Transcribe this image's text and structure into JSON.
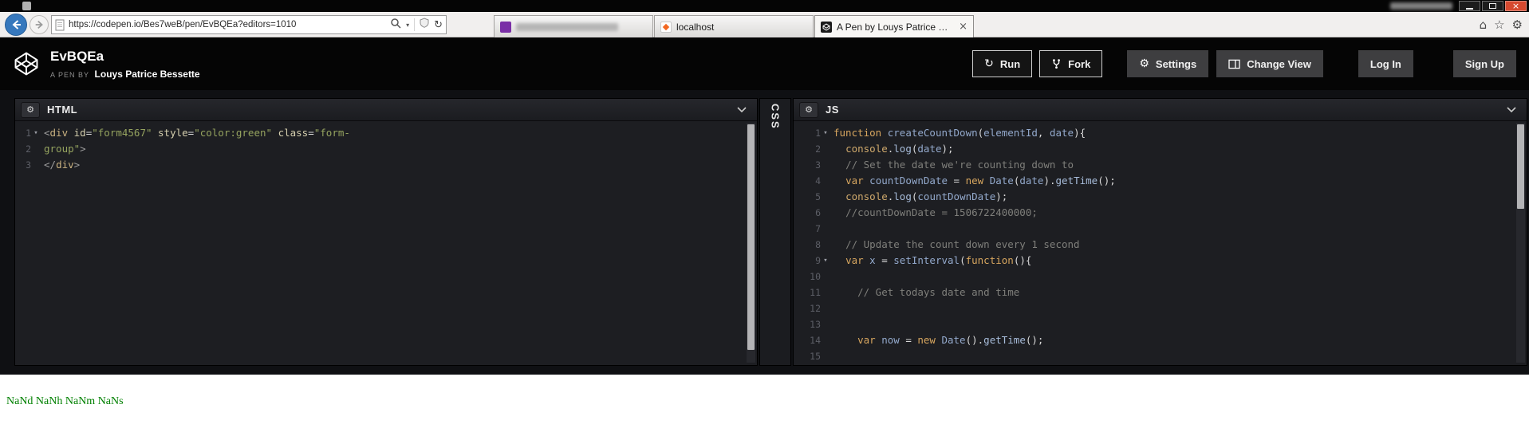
{
  "colors": {
    "output_text": "#008000",
    "back_button_accent": "#3678bd",
    "close_button": "#d6492f",
    "editor_background": "#1d1e22"
  },
  "browser": {
    "url": "https://codepen.io/Bes7weB/pen/EvBQEa?editors=1010",
    "tabs": [
      {
        "label": "",
        "blurred": true
      },
      {
        "label": "localhost",
        "blurred": false
      },
      {
        "label": "A Pen by Louys Patrice Bess...",
        "blurred": false,
        "active": true,
        "close_glyph": "×"
      }
    ],
    "icons": {
      "home": "⌂",
      "favorites": "☆",
      "tools": "⚙",
      "refresh": "↻",
      "caret_down": "▾",
      "close_window": "×"
    }
  },
  "header": {
    "pen_title": "EvBQEa",
    "byline_prefix": "A PEN BY",
    "author": "Louys Patrice Bessette",
    "buttons": {
      "run": "Run",
      "fork": "Fork",
      "settings": "Settings",
      "change_view": "Change View",
      "log_in": "Log In",
      "sign_up": "Sign Up"
    },
    "icons": {
      "run": "↻",
      "settings": "⚙"
    }
  },
  "editors": {
    "gear_glyph": "⚙",
    "fold_glyph": "▾",
    "html": {
      "label": "HTML",
      "lines": [
        {
          "n": "1",
          "fold": true,
          "t": [
            [
              "br",
              "<"
            ],
            [
              "tag",
              "div"
            ],
            [
              "pl",
              " "
            ],
            [
              "attr",
              "id"
            ],
            [
              "op",
              "="
            ],
            [
              "str",
              "\"form4567\""
            ],
            [
              "pl",
              " "
            ],
            [
              "attr",
              "style"
            ],
            [
              "op",
              "="
            ],
            [
              "str",
              "\"color:green\""
            ],
            [
              "pl",
              " "
            ],
            [
              "attr",
              "class"
            ],
            [
              "op",
              "="
            ],
            [
              "str",
              "\"form-"
            ]
          ]
        },
        {
          "n": "2",
          "t": [
            [
              "str",
              "group\""
            ],
            [
              "br",
              ">"
            ]
          ]
        },
        {
          "n": "3",
          "t": [
            [
              "br",
              "</"
            ],
            [
              "tag",
              "div"
            ],
            [
              "br",
              ">"
            ]
          ]
        }
      ]
    },
    "css": {
      "label": "CSS"
    },
    "js": {
      "label": "JS",
      "lines": [
        {
          "n": "1",
          "fold": true,
          "t": [
            [
              "kw",
              "function"
            ],
            [
              "pl",
              " "
            ],
            [
              "def",
              "createCountDown"
            ],
            [
              "pl",
              "("
            ],
            [
              "def",
              "elementId"
            ],
            [
              "pl",
              ", "
            ],
            [
              "def",
              "date"
            ],
            [
              "pl",
              "){"
            ]
          ]
        },
        {
          "n": "2",
          "t": [
            [
              "pl",
              "  "
            ],
            [
              "vr",
              "console"
            ],
            [
              "pl",
              "."
            ],
            [
              "prop",
              "log"
            ],
            [
              "pl",
              "("
            ],
            [
              "def",
              "date"
            ],
            [
              "pl",
              ");"
            ]
          ]
        },
        {
          "n": "3",
          "t": [
            [
              "pl",
              "  "
            ],
            [
              "cm",
              "// Set the date we're counting down to"
            ]
          ]
        },
        {
          "n": "4",
          "t": [
            [
              "pl",
              "  "
            ],
            [
              "kw",
              "var"
            ],
            [
              "pl",
              " "
            ],
            [
              "def",
              "countDownDate"
            ],
            [
              "pl",
              " = "
            ],
            [
              "kw",
              "new"
            ],
            [
              "pl",
              " "
            ],
            [
              "def",
              "Date"
            ],
            [
              "pl",
              "("
            ],
            [
              "def",
              "date"
            ],
            [
              "pl",
              ")."
            ],
            [
              "prop",
              "getTime"
            ],
            [
              "pl",
              "();"
            ]
          ]
        },
        {
          "n": "5",
          "t": [
            [
              "pl",
              "  "
            ],
            [
              "vr",
              "console"
            ],
            [
              "pl",
              "."
            ],
            [
              "prop",
              "log"
            ],
            [
              "pl",
              "("
            ],
            [
              "def",
              "countDownDate"
            ],
            [
              "pl",
              ");"
            ]
          ]
        },
        {
          "n": "6",
          "t": [
            [
              "pl",
              "  "
            ],
            [
              "cm",
              "//countDownDate = 1506722400000;"
            ]
          ]
        },
        {
          "n": "7",
          "t": []
        },
        {
          "n": "8",
          "t": [
            [
              "pl",
              "  "
            ],
            [
              "cm",
              "// Update the count down every 1 second"
            ]
          ]
        },
        {
          "n": "9",
          "fold": true,
          "t": [
            [
              "pl",
              "  "
            ],
            [
              "kw",
              "var"
            ],
            [
              "pl",
              " "
            ],
            [
              "def",
              "x"
            ],
            [
              "pl",
              " = "
            ],
            [
              "def",
              "setInterval"
            ],
            [
              "pl",
              "("
            ],
            [
              "kw",
              "function"
            ],
            [
              "pl",
              "(){"
            ]
          ]
        },
        {
          "n": "10",
          "t": []
        },
        {
          "n": "11",
          "t": [
            [
              "pl",
              "    "
            ],
            [
              "cm",
              "// Get todays date and time"
            ]
          ]
        },
        {
          "n": "12",
          "t": []
        },
        {
          "n": "13",
          "t": []
        },
        {
          "n": "14",
          "t": [
            [
              "pl",
              "    "
            ],
            [
              "kw",
              "var"
            ],
            [
              "pl",
              " "
            ],
            [
              "def",
              "now"
            ],
            [
              "pl",
              " = "
            ],
            [
              "kw",
              "new"
            ],
            [
              "pl",
              " "
            ],
            [
              "def",
              "Date"
            ],
            [
              "pl",
              "()."
            ],
            [
              "prop",
              "getTime"
            ],
            [
              "pl",
              "();"
            ]
          ]
        },
        {
          "n": "15",
          "t": []
        }
      ]
    }
  },
  "output": {
    "text": "NaNd NaNh NaNm NaNs"
  }
}
